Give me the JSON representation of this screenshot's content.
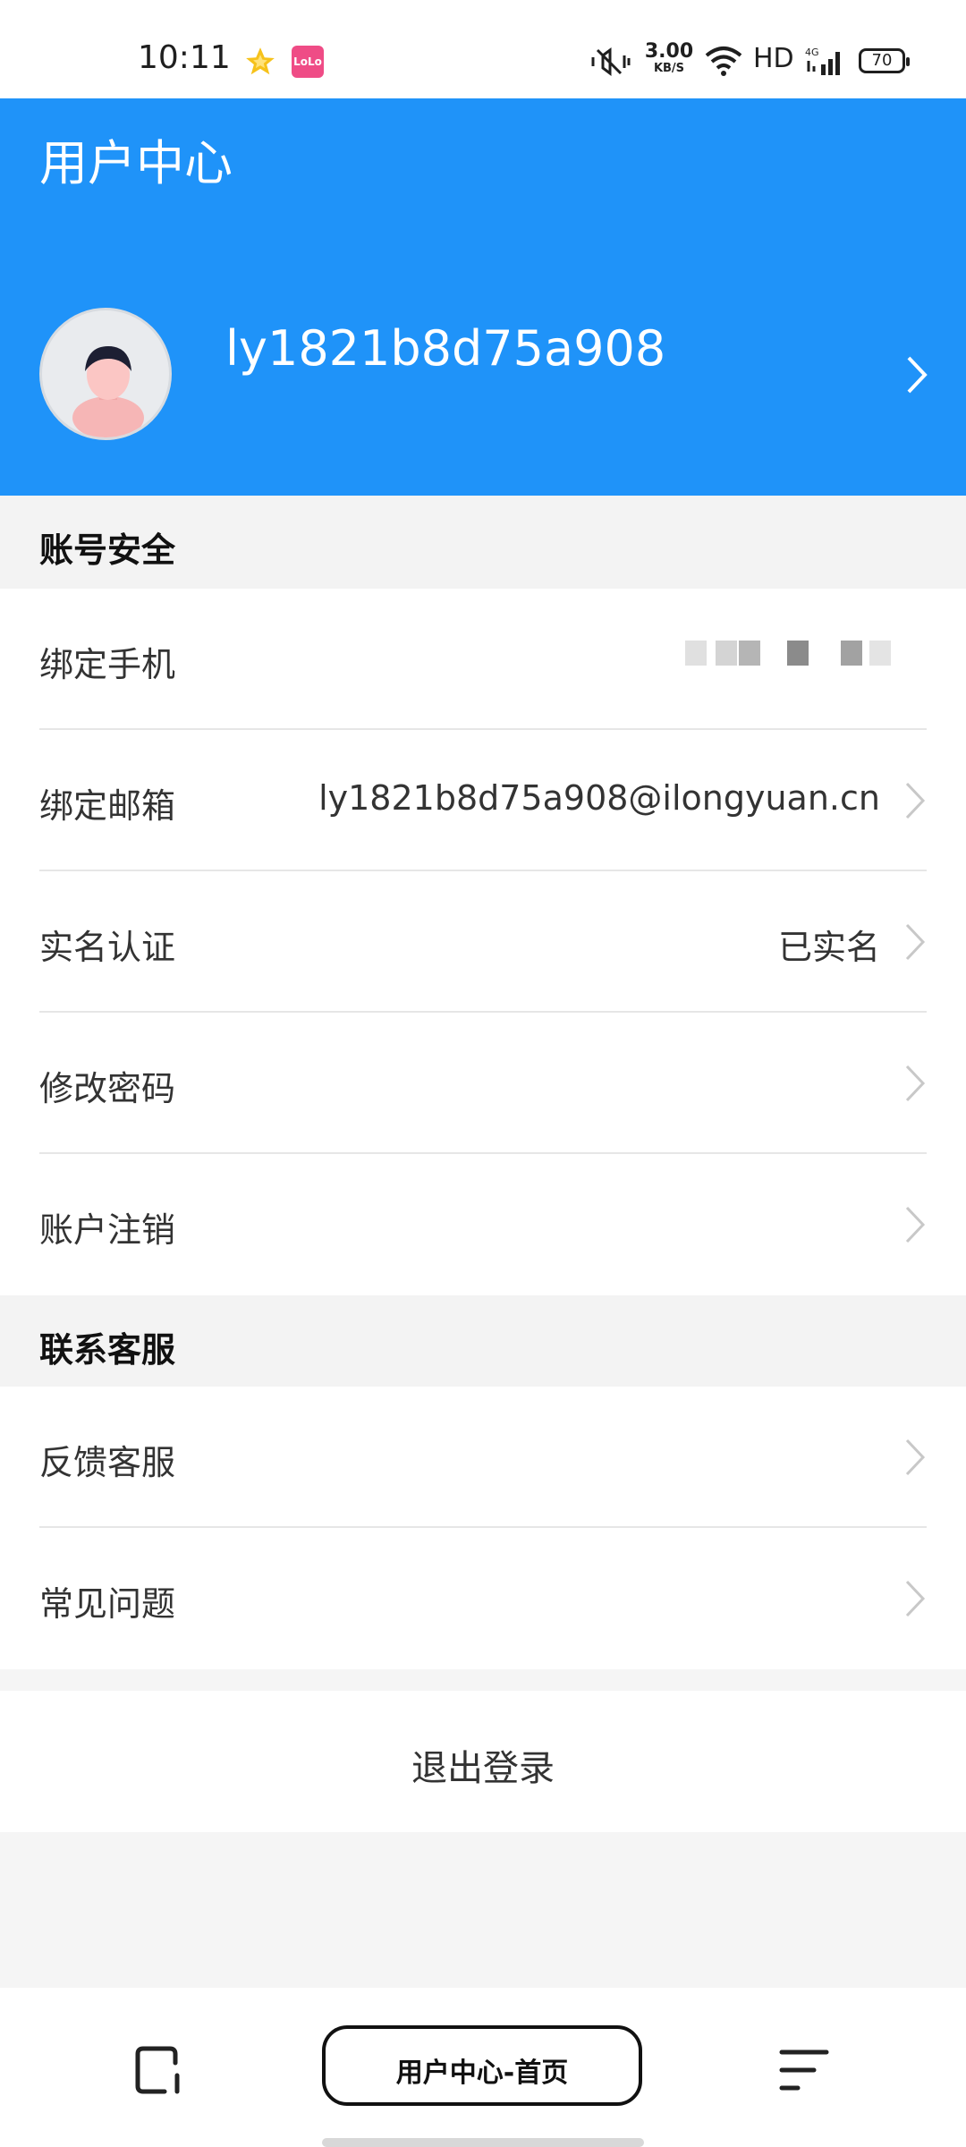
{
  "status_bar": {
    "time": "10:11",
    "speed_value": "3.00",
    "speed_unit": "KB/S",
    "hd": "HD",
    "signal": "4G",
    "battery": "70",
    "app_icon_text": "LoLo"
  },
  "header": {
    "title": "用户中心",
    "username": "ly1821b8d75a908",
    "background_color": "#1f93f9"
  },
  "account_security": {
    "section_title": "账号安全",
    "items": [
      {
        "label": "绑定手机",
        "value": ""
      },
      {
        "label": "绑定邮箱",
        "value": "ly1821b8d75a908@ilongyuan.cn"
      },
      {
        "label": "实名认证",
        "value": "已实名"
      },
      {
        "label": "修改密码",
        "value": ""
      },
      {
        "label": "账户注销",
        "value": ""
      }
    ]
  },
  "contact_support": {
    "section_title": "联系客服",
    "items": [
      {
        "label": "反馈客服"
      },
      {
        "label": "常见问题"
      }
    ]
  },
  "logout_label": "退出登录",
  "bottom_nav": {
    "center_label": "用户中心-首页"
  }
}
